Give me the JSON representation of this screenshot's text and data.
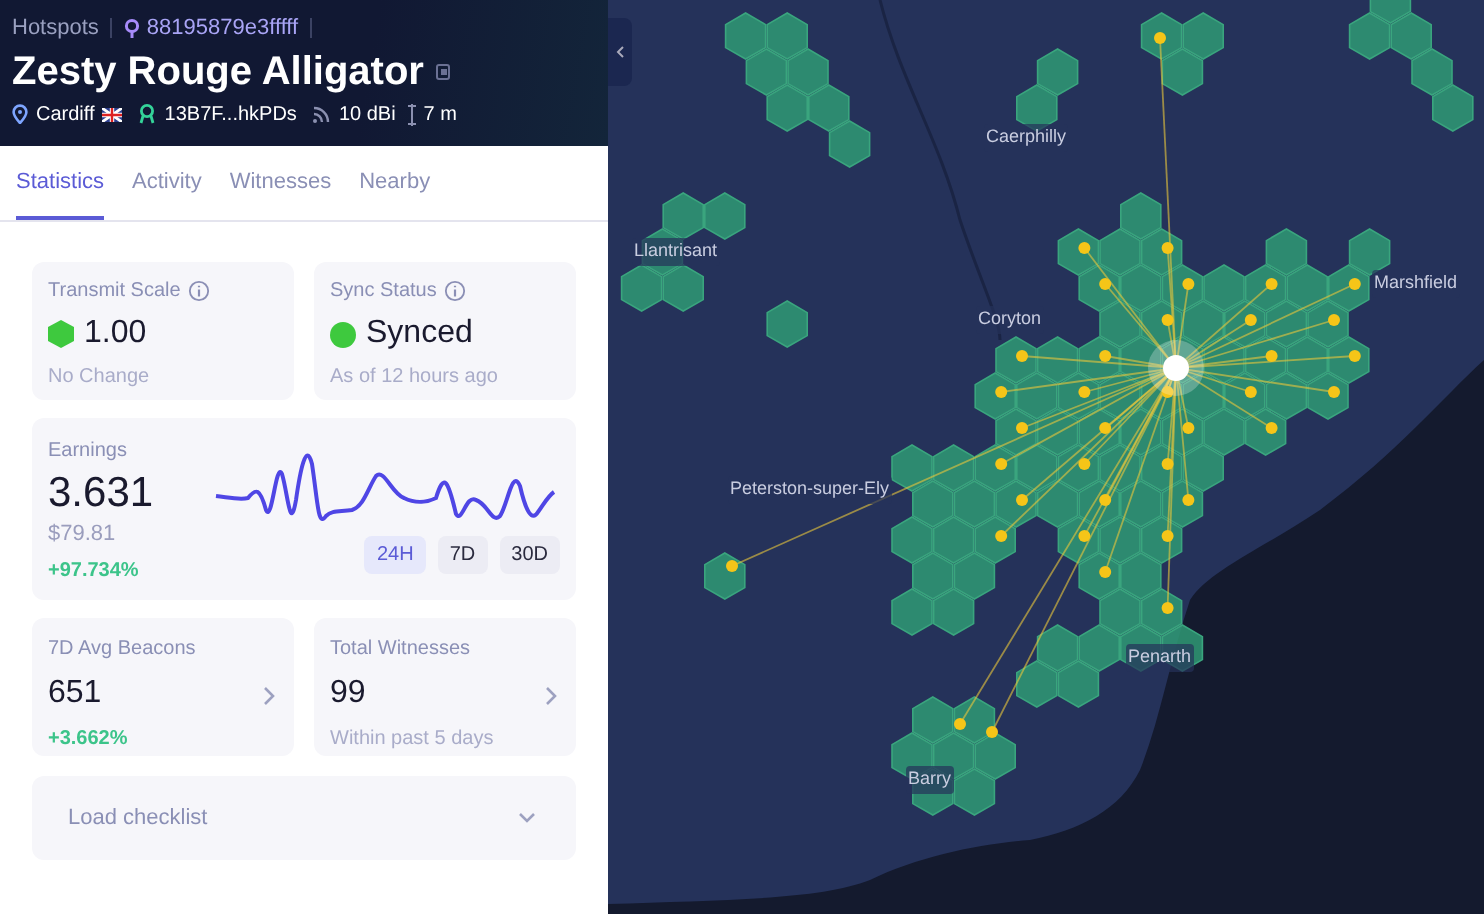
{
  "breadcrumb": {
    "section": "Hotspots",
    "hotspot_id": "88195879e3fffff"
  },
  "title": "Zesty Rouge Alligator",
  "meta": {
    "city": "Cardiff",
    "owner": "13B7F...hkPDs",
    "gain": "10 dBi",
    "elevation": "7 m"
  },
  "tabs": [
    {
      "label": "Statistics",
      "selected": true
    },
    {
      "label": "Activity",
      "selected": false
    },
    {
      "label": "Witnesses",
      "selected": false
    },
    {
      "label": "Nearby",
      "selected": false
    }
  ],
  "transmit_scale": {
    "label": "Transmit Scale",
    "value": "1.00",
    "note": "No Change",
    "color": "#3ec93e"
  },
  "sync_status": {
    "label": "Sync Status",
    "value": "Synced",
    "note": "As of 12 hours ago",
    "color": "#3ec93e"
  },
  "earnings": {
    "label": "Earnings",
    "value": "3.631",
    "usd": "$79.81",
    "change": "+97.734%",
    "periods": [
      {
        "label": "24H",
        "selected": true
      },
      {
        "label": "7D",
        "selected": false
      },
      {
        "label": "30D",
        "selected": false
      }
    ]
  },
  "beacons": {
    "label": "7D Avg Beacons",
    "value": "651",
    "change": "+3.662%"
  },
  "witnesses": {
    "label": "Total Witnesses",
    "value": "99",
    "note": "Within past 5 days"
  },
  "checklist": {
    "label": "Load checklist",
    "expanded": false
  },
  "map": {
    "places": [
      "Caerphilly",
      "Llantrisant",
      "Coryton",
      "Marshfield",
      "Peterston-super-Ely",
      "Penarth",
      "Barry"
    ]
  }
}
